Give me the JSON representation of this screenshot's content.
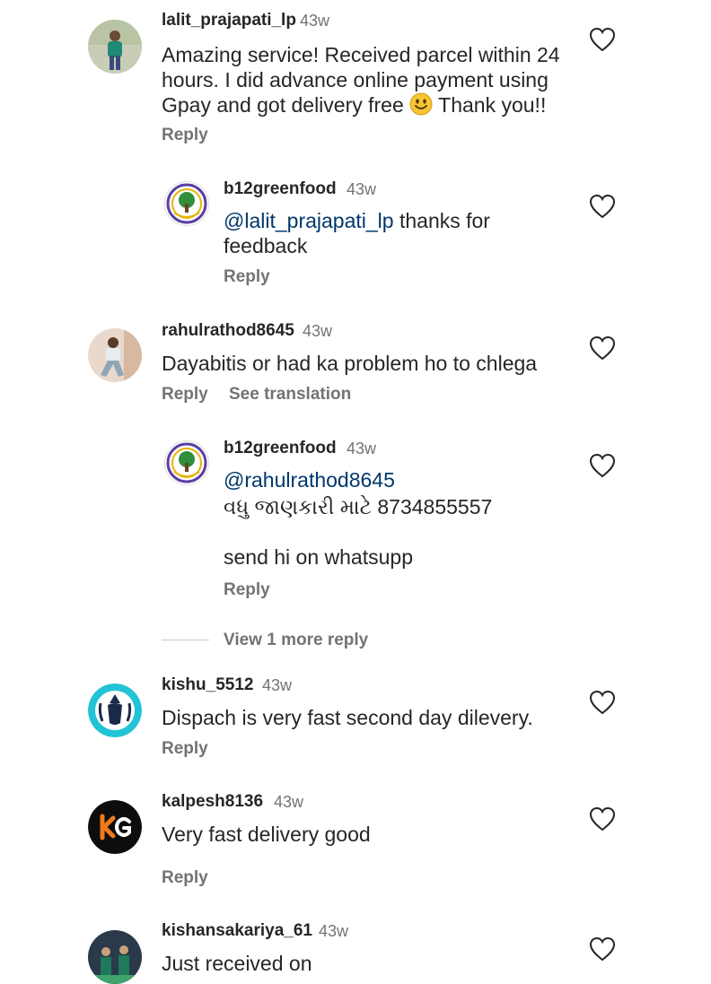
{
  "comments": [
    {
      "username": "lalit_prajapati_lp",
      "time": "43w",
      "text_lines": [
        "Amazing service! Received parcel within 24",
        "hours. I did advance online payment using",
        "Gpay and got delivery free",
        "Thank you!!"
      ],
      "emoji": "slightly-smiling-face",
      "reply_label": "Reply"
    },
    {
      "username": "b12greenfood",
      "time": "43w",
      "mention": "@lalit_prajapati_lp",
      "text_lines": [
        " thanks for",
        "feedback"
      ],
      "reply_label": "Reply"
    },
    {
      "username": "rahulrathod8645",
      "time": "43w",
      "text_lines": [
        "Dayabitis or had ka problem ho to chlega"
      ],
      "reply_label": "Reply",
      "translation_label": "See translation"
    },
    {
      "username": "b12greenfood",
      "time": "43w",
      "mention": "@rahulrathod8645",
      "text_lines": [
        "વધુ જાણકારી માટે  8734855557",
        "send hi on whatsupp"
      ],
      "reply_label": "Reply"
    },
    {
      "username": "kishu_5512",
      "time": "43w",
      "text_lines": [
        "Dispach is very fast second day dilevery."
      ],
      "reply_label": "Reply"
    },
    {
      "username": "kalpesh8136",
      "time": "43w",
      "text_lines": [
        "Very fast delivery good"
      ],
      "reply_label": "Reply"
    },
    {
      "username": "kishansakariya_61",
      "time": "43w",
      "text_lines": [
        "Just received on"
      ]
    }
  ],
  "view_more_label": "View 1 more reply",
  "icons": {
    "like": "heart-outline-icon"
  },
  "colors": {
    "text": "#262626",
    "secondary": "#737373",
    "mention": "#00376b"
  }
}
